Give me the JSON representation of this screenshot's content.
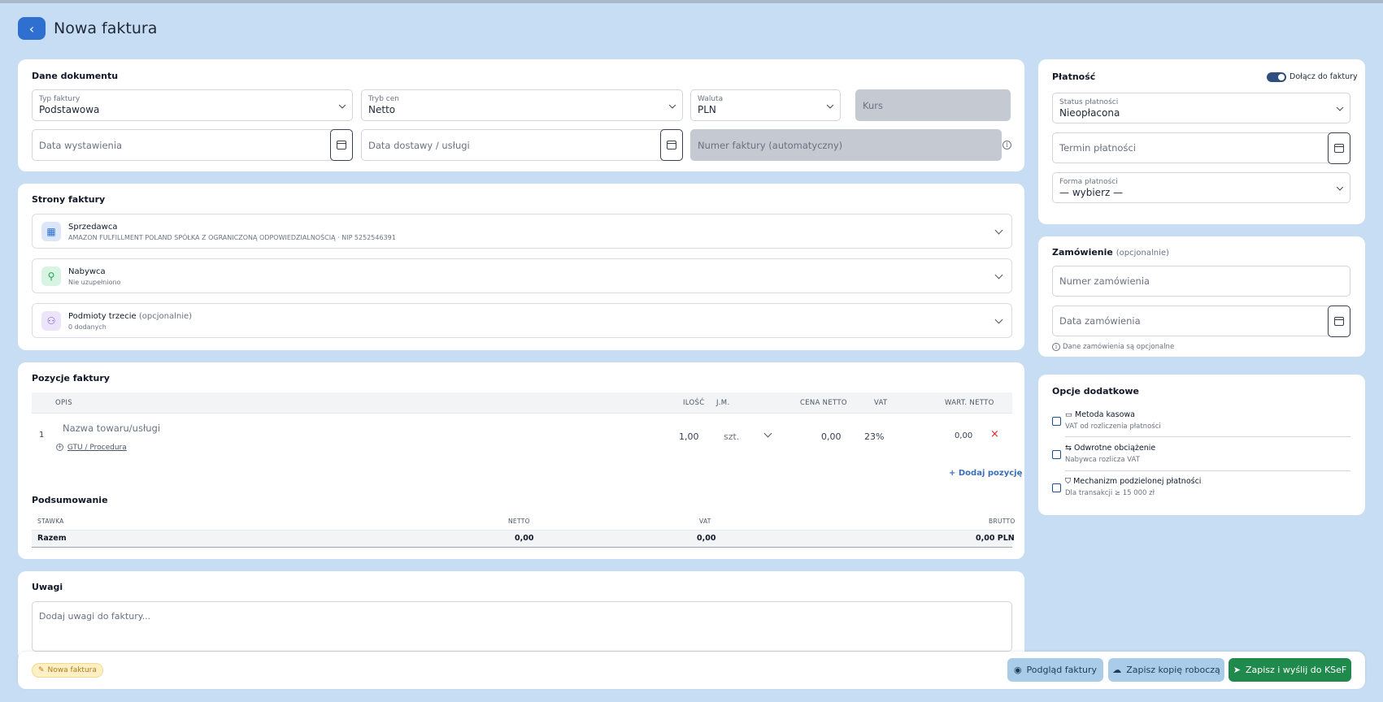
{
  "header": {
    "back_icon": "‹",
    "title": "Nowa faktura"
  },
  "document": {
    "title": "Dane dokumentu",
    "invoice_type": {
      "label": "Typ faktury",
      "value": "Podstawowa"
    },
    "price_mode": {
      "label": "Tryb cen",
      "value": "Netto"
    },
    "currency": {
      "label": "Waluta",
      "value": "PLN"
    },
    "rate_placeholder": "Kurs",
    "issue_date_placeholder": "Data wystawienia",
    "delivery_date_placeholder": "Data dostawy / usługi",
    "number_placeholder": "Numer faktury (automatyczny)"
  },
  "parties": {
    "title": "Strony faktury",
    "seller": {
      "title": "Sprzedawca",
      "subtitle": "AMAZON FULFILLMENT POLAND SPÓŁKA Z OGRANICZONĄ ODPOWIEDZIALNOŚCIĄ · NIP 5252546391"
    },
    "buyer": {
      "title": "Nabywca",
      "subtitle": "Nie uzupełniono"
    },
    "third": {
      "title": "Podmioty trzecie",
      "optional": "(opcjonalnie)",
      "subtitle": "0 dodanych"
    }
  },
  "items": {
    "title": "Pozycje faktury",
    "headers": {
      "desc": "OPIS",
      "qty": "ILOŚĆ",
      "unit": "J.M.",
      "net_price": "CENA NETTO",
      "vat": "VAT",
      "net_value": "WART. NETTO"
    },
    "rows": [
      {
        "lp": "1",
        "name_placeholder": "Nazwa towaru/usługi",
        "gtu": "GTU / Procedura",
        "qty": "1,00",
        "unit": "szt.",
        "net_price": "0,00",
        "vat": "23%",
        "net_value": "0,00"
      }
    ],
    "add_label": "Dodaj pozycję"
  },
  "summary": {
    "title": "Podsumowanie",
    "headers": {
      "rate": "STAWKA",
      "net": "NETTO",
      "vat": "VAT",
      "gross": "BRUTTO"
    },
    "total": {
      "label": "Razem",
      "net": "0,00",
      "vat": "0,00",
      "gross": "0,00 PLN"
    }
  },
  "notes": {
    "title": "Uwagi",
    "placeholder": "Dodaj uwagi do faktury..."
  },
  "payment": {
    "title": "Płatność",
    "attach_label": "Dołącz do faktury",
    "attach_on": true,
    "status": {
      "label": "Status płatności",
      "value": "Nieopłacona"
    },
    "due_placeholder": "Termin płatności",
    "method": {
      "label": "Forma płatności",
      "value": "— wybierz —"
    }
  },
  "order": {
    "title": "Zamówienie",
    "optional": "(opcjonalnie)",
    "number_placeholder": "Numer zamówienia",
    "date_placeholder": "Data zamówienia",
    "hint": "Dane zamówienia są opcjonalne"
  },
  "options": {
    "title": "Opcje dodatkowe",
    "items": [
      {
        "icon": "▭",
        "title": "Metoda kasowa",
        "subtitle": "VAT od rozliczenia płatności"
      },
      {
        "icon": "⇆",
        "title": "Odwrotne obciążenie",
        "subtitle": "Nabywca rozlicza VAT"
      },
      {
        "icon": "⛉",
        "title": "Mechanizm podzielonej płatności",
        "subtitle": "Dla transakcji ≥ 15 000 zł"
      }
    ]
  },
  "footer": {
    "badge": "Nowa faktura",
    "preview_label": "Podgląd faktury",
    "draft_label": "Zapisz kopię roboczą",
    "send_label": "Zapisz i wyślij do KSeF"
  },
  "colors": {
    "background": "#c6ddf3",
    "primary": "#2f6fd0",
    "send_green": "#1f8a4c",
    "secondary_btn": "#a9cde8",
    "badge_bg": "#fdf0c4"
  }
}
